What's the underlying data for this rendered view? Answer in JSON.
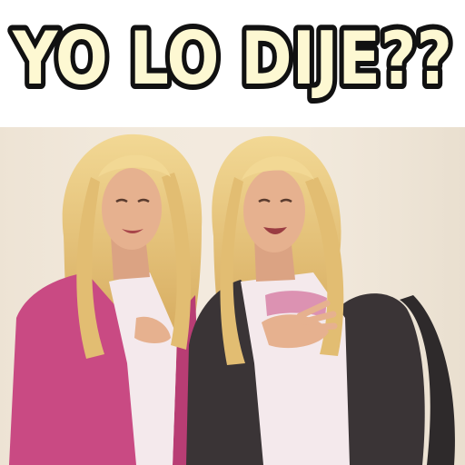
{
  "caption": {
    "text": "YO LO DIJE??"
  },
  "colors": {
    "caption_fill": "#fdf8d2",
    "caption_outline": "#111111",
    "hair": "#e9c77f",
    "hair_shadow": "#c99d52",
    "skin": "#e6b18f",
    "pink_jacket": "#c94a83",
    "denim_jacket": "#3a3436",
    "shirt": "#f4e9ec",
    "backdrop": "#f2e9dc"
  }
}
